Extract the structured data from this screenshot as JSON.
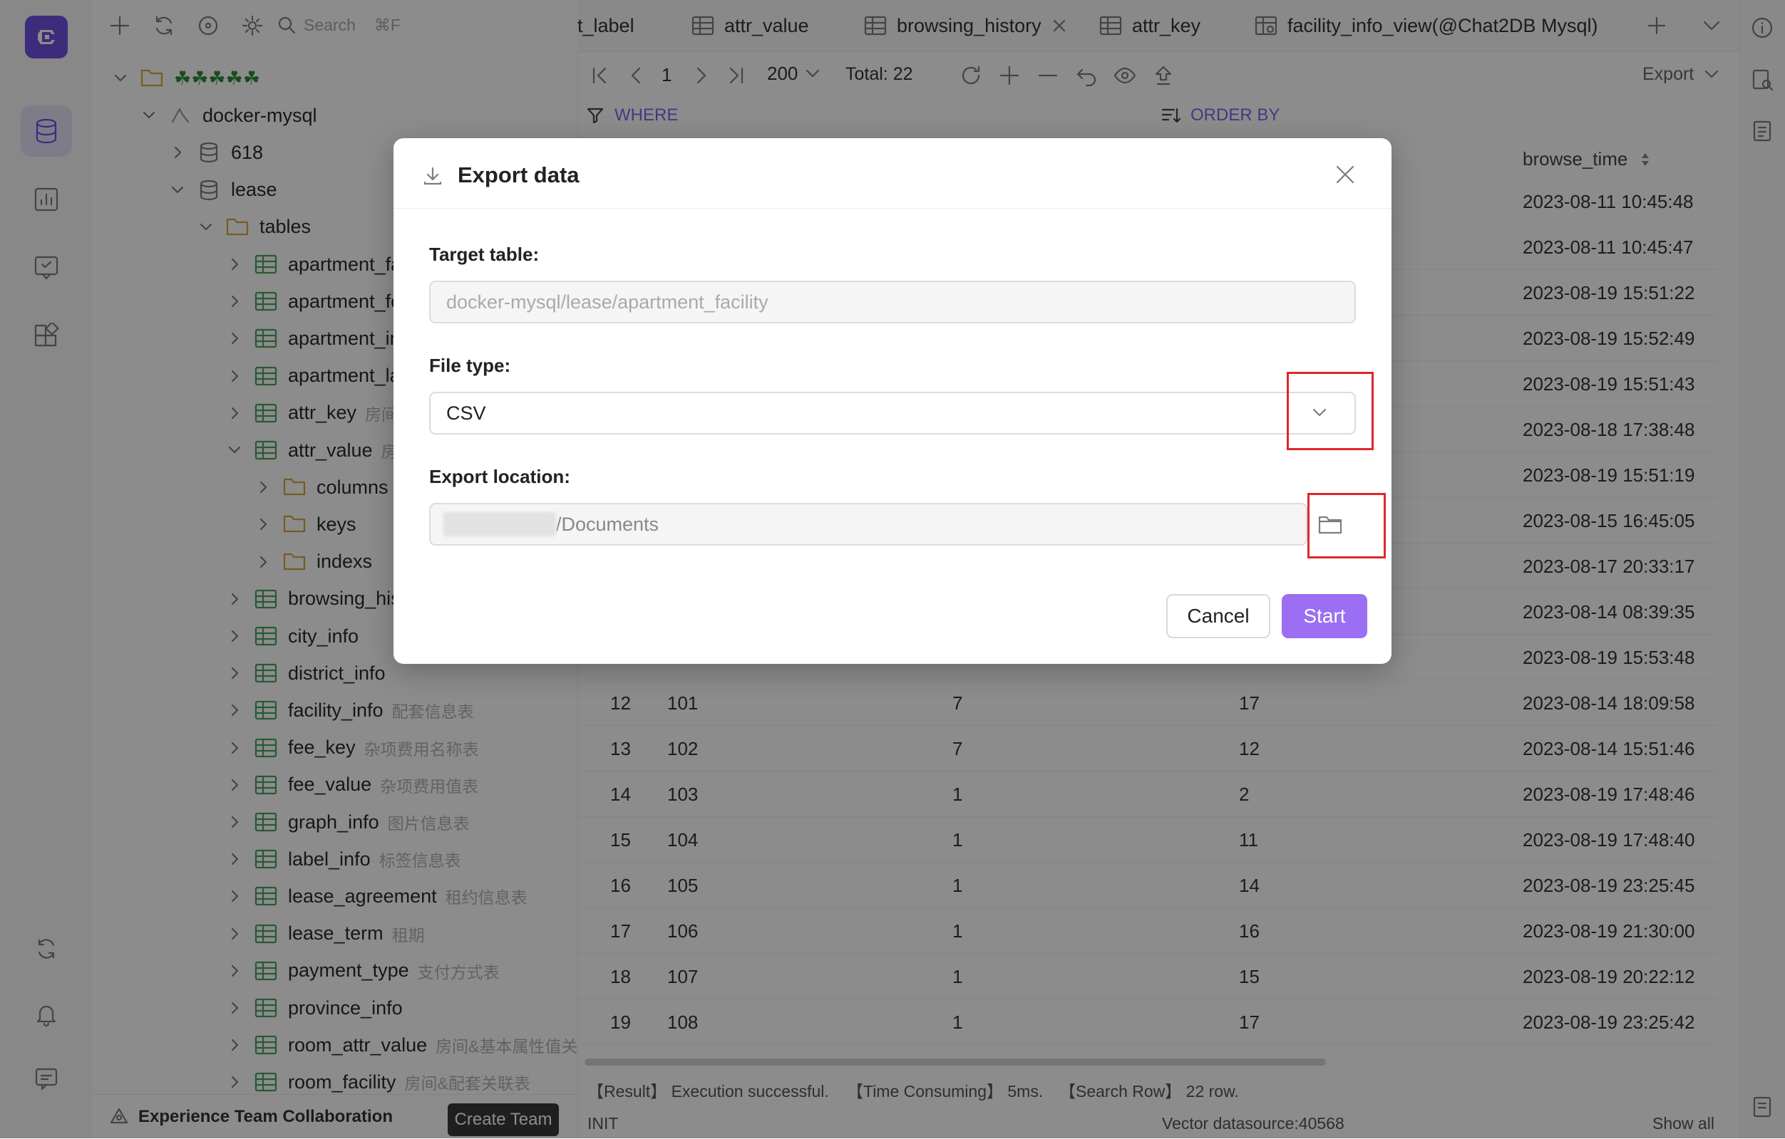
{
  "rail": {
    "items": [
      "database",
      "dashboard",
      "chat",
      "apps"
    ],
    "bottom": [
      "sync",
      "notifications",
      "feedback"
    ]
  },
  "sidebar": {
    "search_placeholder": "Search",
    "search_shortcut": "⌘F",
    "tree": [
      {
        "label": "☘☘☘☘☘",
        "level": 0,
        "icon": "folder-icon",
        "expanded": true
      },
      {
        "label": "docker-mysql",
        "level": 1,
        "icon": "connection-icon",
        "expanded": true
      },
      {
        "label": "618",
        "level": 2,
        "icon": "database-icon",
        "expanded": false
      },
      {
        "label": "lease",
        "level": 2,
        "icon": "database-icon",
        "expanded": true
      },
      {
        "label": "tables",
        "level": 3,
        "icon": "folder-icon",
        "expanded": true
      },
      {
        "label": "apartment_fa",
        "level": 4,
        "icon": "table-icon",
        "comment": ""
      },
      {
        "label": "apartment_fe",
        "level": 4,
        "icon": "table-icon",
        "comment": ""
      },
      {
        "label": "apartment_in",
        "level": 4,
        "icon": "table-icon",
        "comment": ""
      },
      {
        "label": "apartment_la",
        "level": 4,
        "icon": "table-icon",
        "comment": ""
      },
      {
        "label": "attr_key",
        "level": 4,
        "icon": "table-icon",
        "comment": "房间"
      },
      {
        "label": "attr_value",
        "level": 4,
        "icon": "table-icon",
        "comment": "房",
        "expanded": true
      },
      {
        "label": "columns",
        "level": 5,
        "icon": "folder-icon",
        "comment": ""
      },
      {
        "label": "keys",
        "level": 5,
        "icon": "folder-icon",
        "comment": ""
      },
      {
        "label": "indexs",
        "level": 5,
        "icon": "folder-icon",
        "comment": ""
      },
      {
        "label": "browsing_his",
        "level": 4,
        "icon": "table-icon",
        "comment": ""
      },
      {
        "label": "city_info",
        "level": 4,
        "icon": "table-icon",
        "comment": ""
      },
      {
        "label": "district_info",
        "level": 4,
        "icon": "table-icon",
        "comment": ""
      },
      {
        "label": "facility_info",
        "level": 4,
        "icon": "table-icon",
        "comment": "配套信息表"
      },
      {
        "label": "fee_key",
        "level": 4,
        "icon": "table-icon",
        "comment": "杂项费用名称表"
      },
      {
        "label": "fee_value",
        "level": 4,
        "icon": "table-icon",
        "comment": "杂项费用值表"
      },
      {
        "label": "graph_info",
        "level": 4,
        "icon": "table-icon",
        "comment": "图片信息表"
      },
      {
        "label": "label_info",
        "level": 4,
        "icon": "table-icon",
        "comment": "标签信息表"
      },
      {
        "label": "lease_agreement",
        "level": 4,
        "icon": "table-icon",
        "comment": "租约信息表"
      },
      {
        "label": "lease_term",
        "level": 4,
        "icon": "table-icon",
        "comment": "租期"
      },
      {
        "label": "payment_type",
        "level": 4,
        "icon": "table-icon",
        "comment": "支付方式表"
      },
      {
        "label": "province_info",
        "level": 4,
        "icon": "table-icon",
        "comment": ""
      },
      {
        "label": "room_attr_value",
        "level": 4,
        "icon": "table-icon",
        "comment": "房间&基本属性值关"
      },
      {
        "label": "room_facility",
        "level": 4,
        "icon": "table-icon",
        "comment": "房间&配套关联表"
      }
    ],
    "team_text": "Experience Team Collaboration",
    "create_team": "Create Team"
  },
  "tabs": [
    {
      "label": "t_label"
    },
    {
      "label": "attr_value"
    },
    {
      "label": "browsing_history",
      "closable": true
    },
    {
      "label": "attr_key"
    },
    {
      "label": "facility_info_view(@Chat2DB Mysql)"
    }
  ],
  "toolbar": {
    "page": "1",
    "page_size": "200",
    "total_label": "Total:",
    "total_value": "22",
    "export_label": "Export"
  },
  "filters": {
    "where": "WHERE",
    "order_by": "ORDER BY"
  },
  "grid": {
    "sort_column": "browse_time",
    "rows": [
      {
        "no": "",
        "c1": "",
        "c2": "",
        "c3": "",
        "time": "2023-08-11 10:45:48"
      },
      {
        "no": "",
        "c1": "",
        "c2": "",
        "c3": "",
        "time": "2023-08-11 10:45:47"
      },
      {
        "no": "",
        "c1": "",
        "c2": "",
        "c3": "",
        "time": "2023-08-19 15:51:22"
      },
      {
        "no": "",
        "c1": "",
        "c2": "",
        "c3": "",
        "time": "2023-08-19 15:52:49"
      },
      {
        "no": "",
        "c1": "",
        "c2": "",
        "c3": "",
        "time": "2023-08-19 15:51:43"
      },
      {
        "no": "",
        "c1": "",
        "c2": "",
        "c3": "",
        "time": "2023-08-18 17:38:48"
      },
      {
        "no": "",
        "c1": "",
        "c2": "",
        "c3": "",
        "time": "2023-08-19 15:51:19"
      },
      {
        "no": "",
        "c1": "",
        "c2": "",
        "c3": "",
        "time": "2023-08-15 16:45:05"
      },
      {
        "no": "",
        "c1": "",
        "c2": "",
        "c3": "",
        "time": "2023-08-17 20:33:17"
      },
      {
        "no": "",
        "c1": "",
        "c2": "",
        "c3": "",
        "time": "2023-08-14 08:39:35"
      },
      {
        "no": "",
        "c1": "",
        "c2": "",
        "c3": "",
        "time": "2023-08-19 15:53:48"
      },
      {
        "no": "12",
        "c1": "101",
        "c2": "7",
        "c3": "17",
        "time": "2023-08-14 18:09:58"
      },
      {
        "no": "13",
        "c1": "102",
        "c2": "7",
        "c3": "12",
        "time": "2023-08-14 15:51:46"
      },
      {
        "no": "14",
        "c1": "103",
        "c2": "1",
        "c3": "2",
        "time": "2023-08-19 17:48:46"
      },
      {
        "no": "15",
        "c1": "104",
        "c2": "1",
        "c3": "11",
        "time": "2023-08-19 17:48:40"
      },
      {
        "no": "16",
        "c1": "105",
        "c2": "1",
        "c3": "14",
        "time": "2023-08-19 23:25:45"
      },
      {
        "no": "17",
        "c1": "106",
        "c2": "1",
        "c3": "16",
        "time": "2023-08-19 21:30:00"
      },
      {
        "no": "18",
        "c1": "107",
        "c2": "1",
        "c3": "15",
        "time": "2023-08-19 20:22:12"
      },
      {
        "no": "19",
        "c1": "108",
        "c2": "1",
        "c3": "17",
        "time": "2023-08-19 23:25:42"
      }
    ]
  },
  "status": {
    "result": "【Result】 Execution successful.",
    "time": "【Time Consuming】 5ms.",
    "rows": "【Search Row】 22 row.",
    "init": "INIT",
    "datasource": "Vector datasource:40568",
    "show_all": "Show all"
  },
  "modal": {
    "title": "Export data",
    "target_label": "Target table:",
    "target_value": "docker-mysql/lease/apartment_facility",
    "file_type_label": "File type:",
    "file_type_value": "CSV",
    "location_label": "Export location:",
    "location_value": "/Documents",
    "cancel": "Cancel",
    "start": "Start"
  },
  "colors": {
    "accent": "#9b6ef3",
    "highlight": "#e0262b",
    "brand": "#6f4fe0"
  }
}
